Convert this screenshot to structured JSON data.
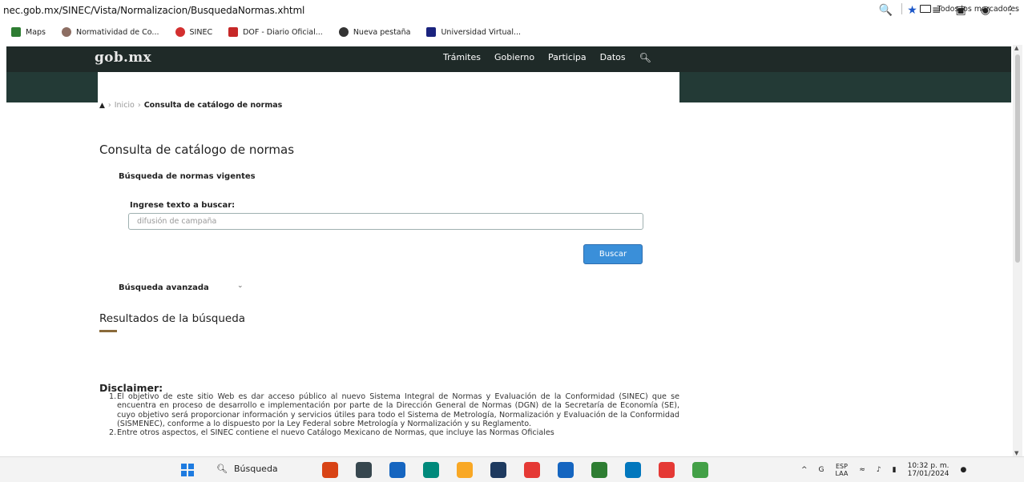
{
  "browser": {
    "url": "nec.gob.mx/SINEC/Vista/Normalizacion/BusquedaNormas.xhtml",
    "bookmarks": [
      {
        "label": "Maps",
        "icon": "maps-icon",
        "color": "#2e7d32"
      },
      {
        "label": "Normatividad de Co...",
        "icon": "seal-icon",
        "color": "#8d6e63"
      },
      {
        "label": "SINEC",
        "icon": "sinec-icon",
        "color": "#d32f2f"
      },
      {
        "label": "DOF - Diario Oficial...",
        "icon": "dof-icon",
        "color": "#c62828"
      },
      {
        "label": "Nueva pestaña",
        "icon": "chrome-icon",
        "color": "#333333"
      },
      {
        "label": "Universidad Virtual...",
        "icon": "university-icon",
        "color": "#1a237e"
      }
    ],
    "all_bookmarks": "Todos los marcadores"
  },
  "header": {
    "logo": "gob.mx",
    "nav": [
      "Trámites",
      "Gobierno",
      "Participa",
      "Datos"
    ],
    "bg_color": "#1f2a28"
  },
  "breadcrumb": {
    "home": "Inicio",
    "current": "Consulta de catálogo de normas"
  },
  "page": {
    "title": "Consulta de catálogo de normas",
    "subtitle": "Búsqueda de normas vigentes",
    "search_label": "Ingrese texto a buscar:",
    "search_value": "difusión de campaña",
    "search_button": "Buscar",
    "advanced": "Búsqueda avanzada",
    "results_title": "Resultados de la búsqueda",
    "accent_color": "#3a8fd9"
  },
  "disclaimer": {
    "title": "Disclaimer:",
    "items": [
      {
        "n": "1.",
        "text": "El objetivo de este sitio Web es dar acceso público al nuevo Sistema Integral de Normas y Evaluación de la Conformidad (SINEC) que se encuentra en proceso de desarrollo e implementación por parte de la Dirección General de Normas (DGN) de la Secretaría de Economía (SE), cuyo objetivo será proporcionar información y servicios útiles para todo el Sistema de Metrología, Normalización y Evaluación de la Conformidad (SISMENEC), conforme a lo dispuesto por la Ley Federal sobre Metrología y Normalización y su Reglamento."
      },
      {
        "n": "2.",
        "text": "Entre otros aspectos, el SINEC contiene el nuevo Catálogo Mexicano de Normas, que incluye las Normas Oficiales"
      }
    ]
  },
  "taskbar": {
    "search": "Búsqueda",
    "lang_top": "ESP",
    "lang_bottom": "LAA",
    "time": "10:32 p. m.",
    "date": "17/01/2024",
    "apps": [
      "#d84315",
      "#37474f",
      "#1565c0",
      "#00897b",
      "#f9a825",
      "#1e3a5f",
      "#e53935",
      "#1565c0",
      "#2e7d32",
      "#0277bd",
      "#e53935",
      "#43a047"
    ]
  }
}
